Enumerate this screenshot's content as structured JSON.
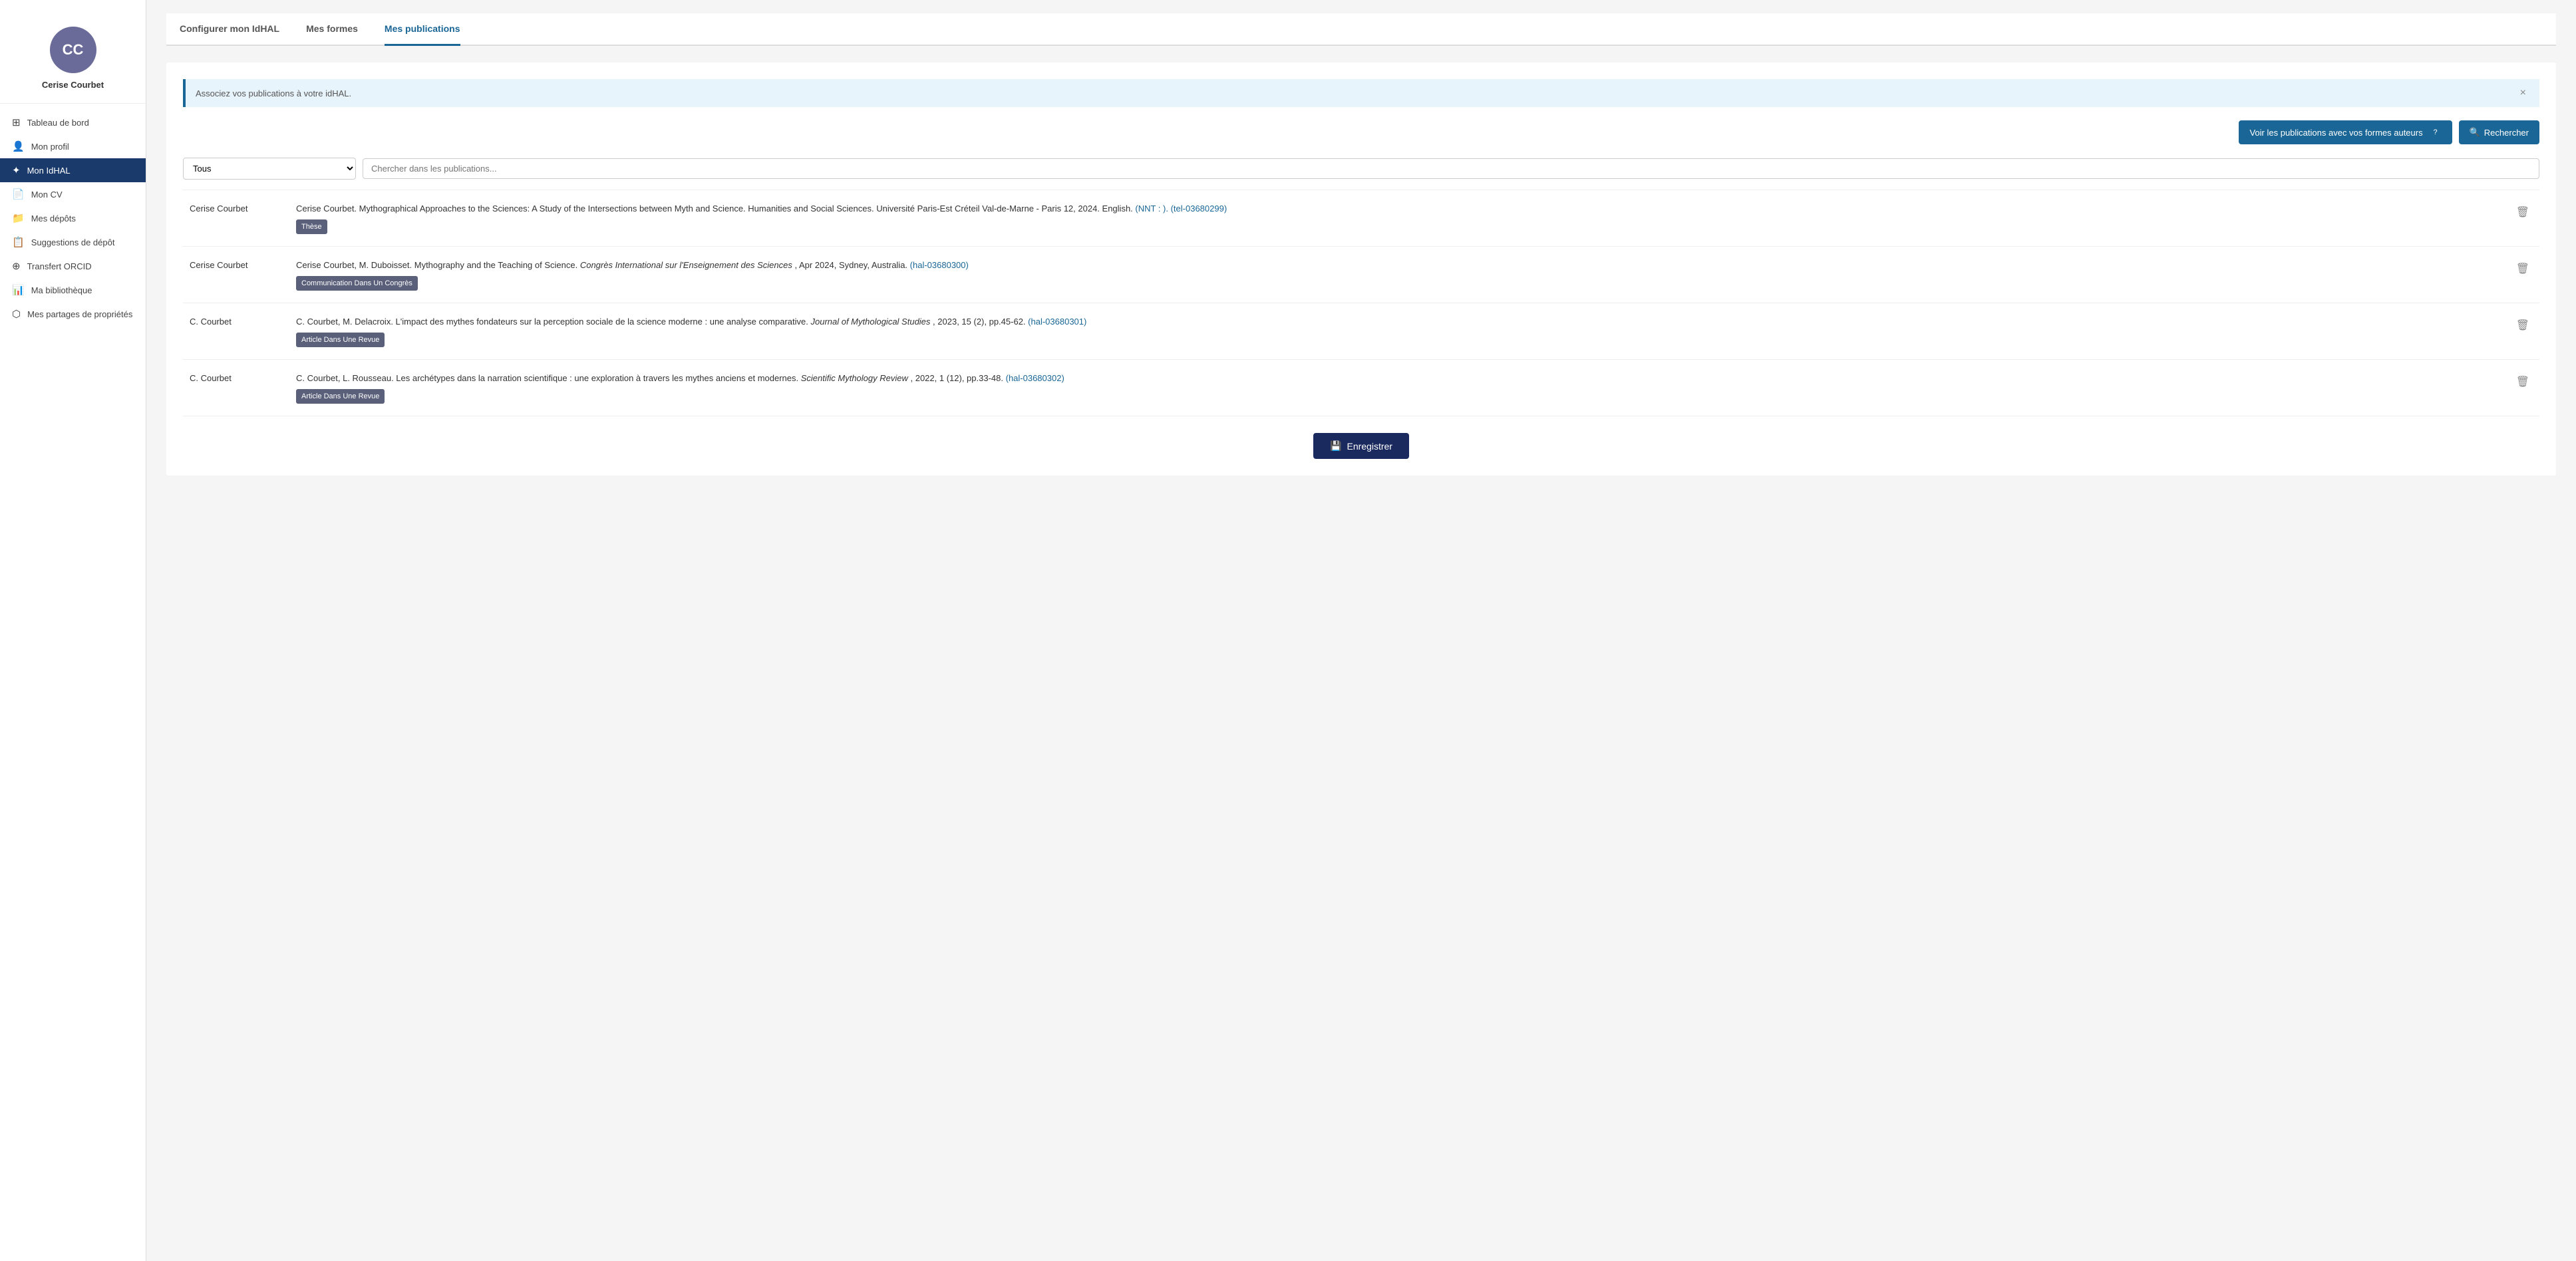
{
  "sidebar": {
    "user": {
      "initials": "CC",
      "name": "Cerise Courbet"
    },
    "nav_items": [
      {
        "id": "tableau-de-bord",
        "label": "Tableau de bord",
        "icon": "⊞",
        "active": false
      },
      {
        "id": "mon-profil",
        "label": "Mon profil",
        "icon": "👤",
        "active": false
      },
      {
        "id": "mon-idhal",
        "label": "Mon IdHAL",
        "icon": "✦",
        "active": true
      },
      {
        "id": "mon-cv",
        "label": "Mon CV",
        "icon": "📄",
        "active": false
      },
      {
        "id": "mes-depots",
        "label": "Mes dépôts",
        "icon": "📁",
        "active": false
      },
      {
        "id": "suggestions-depot",
        "label": "Suggestions de dépôt",
        "icon": "📋",
        "active": false
      },
      {
        "id": "transfert-orcid",
        "label": "Transfert ORCID",
        "icon": "⊕",
        "active": false
      },
      {
        "id": "ma-bibliotheque",
        "label": "Ma bibliothèque",
        "icon": "📊",
        "active": false
      },
      {
        "id": "mes-partages",
        "label": "Mes partages de propriétés",
        "icon": "⬡",
        "active": false
      }
    ]
  },
  "tabs": [
    {
      "id": "configurer-idhal",
      "label": "Configurer mon IdHAL",
      "active": false
    },
    {
      "id": "mes-formes",
      "label": "Mes formes",
      "active": false
    },
    {
      "id": "mes-publications",
      "label": "Mes publications",
      "active": true
    }
  ],
  "info_banner": {
    "text": "Associez vos publications à votre idHAL.",
    "close_label": "×"
  },
  "action_bar": {
    "voir_btn_label": "Voir les publications avec vos formes auteurs",
    "help_label": "?",
    "rechercher_btn_label": "Rechercher",
    "search_icon": "🔍"
  },
  "filter": {
    "select_options": [
      "Tous",
      "Thèse",
      "Article Dans Une Revue",
      "Communication Dans Un Congrès"
    ],
    "select_value": "Tous",
    "search_placeholder": "Chercher dans les publications..."
  },
  "publications": [
    {
      "id": "pub1",
      "author": "Cerise Courbet",
      "text_before_italic": "Cerise Courbet. Mythographical Approaches to the Sciences: A Study of the Intersections between Myth and Science. Humanities and Social Sciences. Université Paris-Est Créteil Val-de-Marne - Paris 12, 2024. English. ",
      "link_text": "(NNT : ). (tel-03680299)",
      "link_href": "#tel-03680299",
      "text_after_link": "",
      "badge": "Thèse"
    },
    {
      "id": "pub2",
      "author": "Cerise Courbet",
      "text_before_italic": "Cerise Courbet, M. Duboisset. Mythography and the Teaching of Science. ",
      "italic_text": "Congrès International sur l'Enseignement des Sciences",
      "text_after_italic": ", Apr 2024, Sydney, Australia. ",
      "link_text": "(hal-03680300)",
      "link_href": "#hal-03680300",
      "text_after_link": "",
      "badge": "Communication Dans Un Congrès"
    },
    {
      "id": "pub3",
      "author": "C. Courbet",
      "text_before_italic": "C. Courbet, M. Delacroix. L'impact des mythes fondateurs sur la perception sociale de la science moderne : une analyse comparative. ",
      "italic_text": "Journal of Mythological Studies",
      "text_after_italic": ", 2023, 15 (2), pp.45-62. ",
      "link_text": "(hal-03680301)",
      "link_href": "#hal-03680301",
      "text_after_link": "",
      "badge": "Article Dans Une Revue"
    },
    {
      "id": "pub4",
      "author": "C. Courbet",
      "text_before_italic": "C. Courbet, L. Rousseau. Les archétypes dans la narration scientifique : une exploration à travers les mythes anciens et modernes. ",
      "italic_text": "Scientific Mythology Review",
      "text_after_italic": ", 2022, 1 (12), pp.33-48. ",
      "link_text": "(hal-03680302)",
      "link_href": "#hal-03680302",
      "text_after_link": "",
      "badge": "Article Dans Une Revue"
    }
  ],
  "save_btn_label": "Enregistrer",
  "save_icon": "💾"
}
